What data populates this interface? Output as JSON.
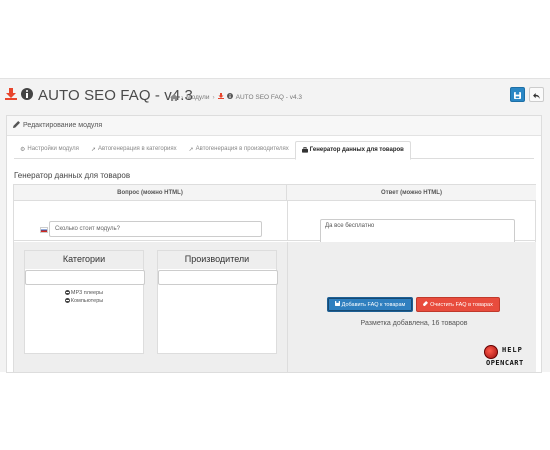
{
  "header": {
    "title": "AUTO SEO FAQ - v4.3",
    "breadcrumb": [
      "Модули",
      "AUTO SEO FAQ - v4.3"
    ]
  },
  "panel": {
    "heading": "Редактирование модуля"
  },
  "tabs": [
    {
      "label": "Настройки модуля",
      "icon": "gear-icon",
      "active": false
    },
    {
      "label": "Автогенерация в категориях",
      "icon": "rocket-icon",
      "active": false
    },
    {
      "label": "Автогенерация в производителях",
      "icon": "rocket-icon",
      "active": false
    },
    {
      "label": "Генератор данных для товаров",
      "icon": "briefcase-icon",
      "active": true
    }
  ],
  "section_title": "Генератор данных для товаров",
  "table": {
    "question_header": "Вопрос (можно HTML)",
    "answer_header": "Ответ (можно HTML)",
    "question_value": "Сколько стоит модуль?",
    "answer_value": "Да все бесплатно"
  },
  "categories": {
    "label": "Категории",
    "items": [
      "MP3 плееры",
      "Компьютеры"
    ]
  },
  "manufacturers": {
    "label": "Производители"
  },
  "buttons": {
    "add": "Добавить FAQ к товарам",
    "clear": "Очистить FAQ в товарах"
  },
  "status_text": "Разметка добавлена, 16 товаров",
  "watermark": {
    "line1": "HELP",
    "line2": "OPENCART"
  },
  "colors": {
    "primary": "#2f7fbf",
    "danger": "#e84c3d",
    "download_icon": "#e8452c"
  }
}
